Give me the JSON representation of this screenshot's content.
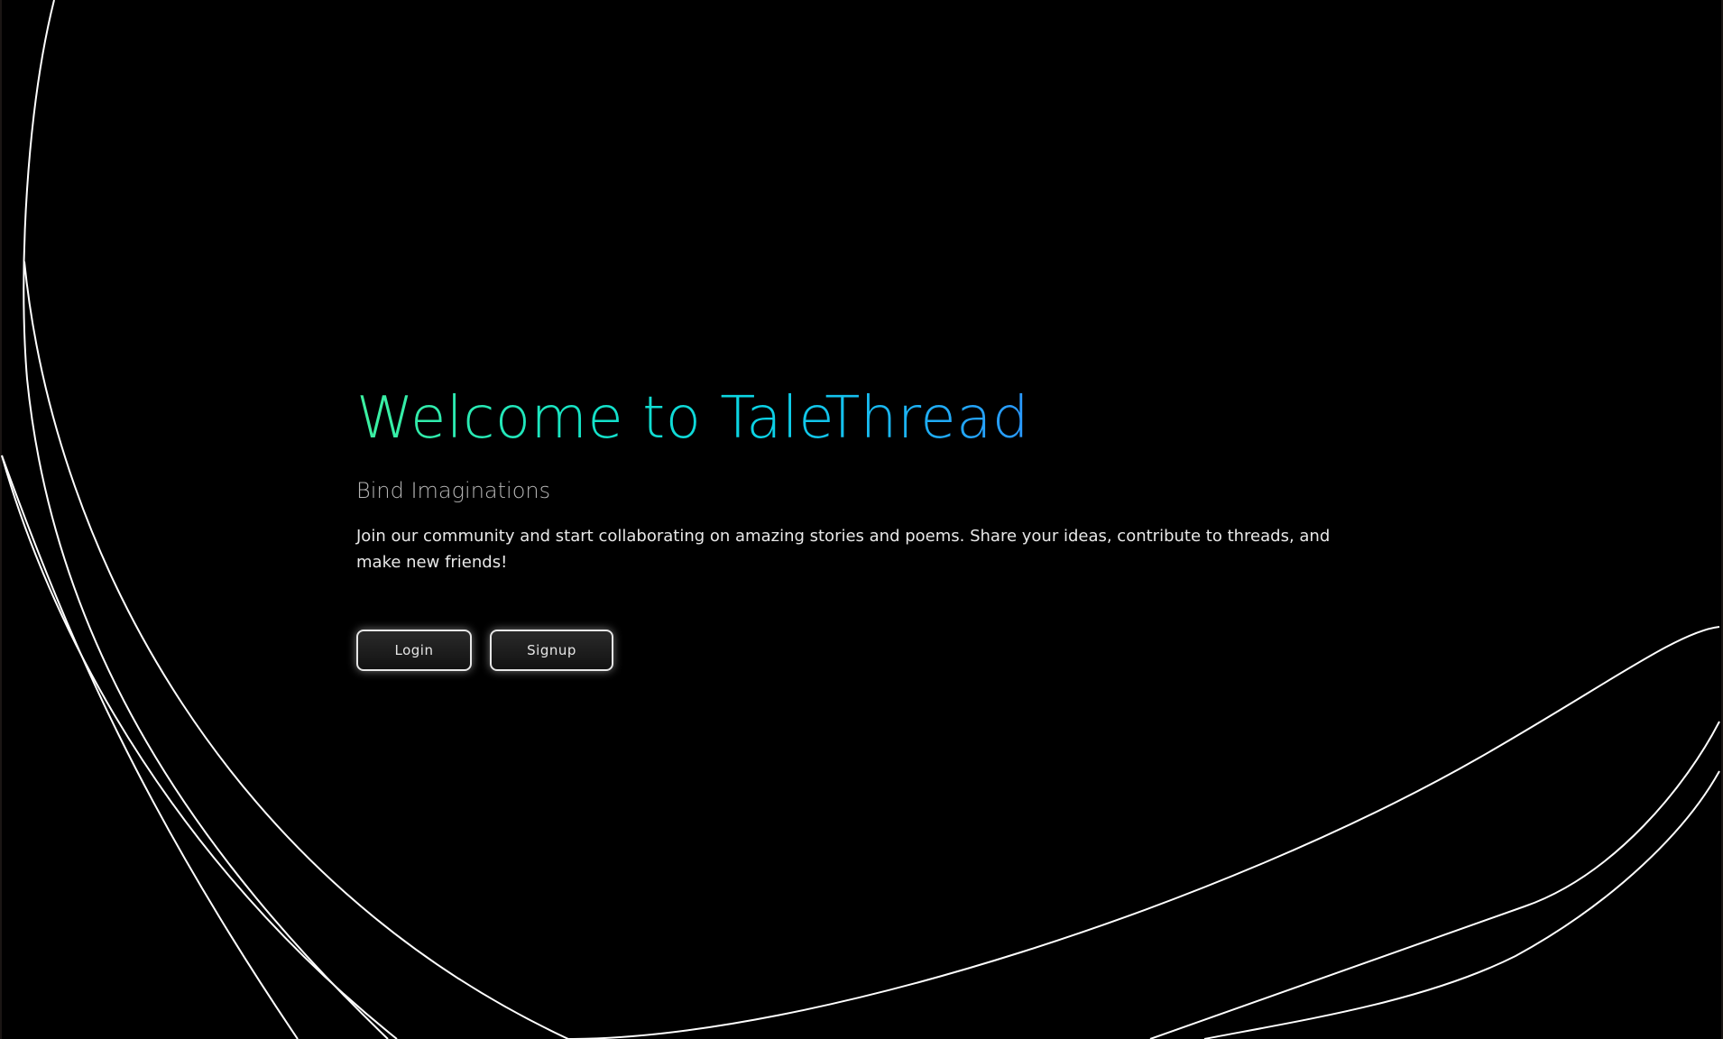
{
  "hero": {
    "title": "Welcome to TaleThread",
    "subtitle": "Bind Imaginations",
    "description": "Join our community and start collaborating on amazing stories and poems. Share your ideas, contribute to threads, and make new friends!"
  },
  "actions": {
    "login_label": "Login",
    "signup_label": "Signup"
  },
  "colors": {
    "background": "#000000",
    "title_gradient_start": "#3df0a0",
    "title_gradient_end": "#2a98ff",
    "lines": "#ffffff"
  }
}
